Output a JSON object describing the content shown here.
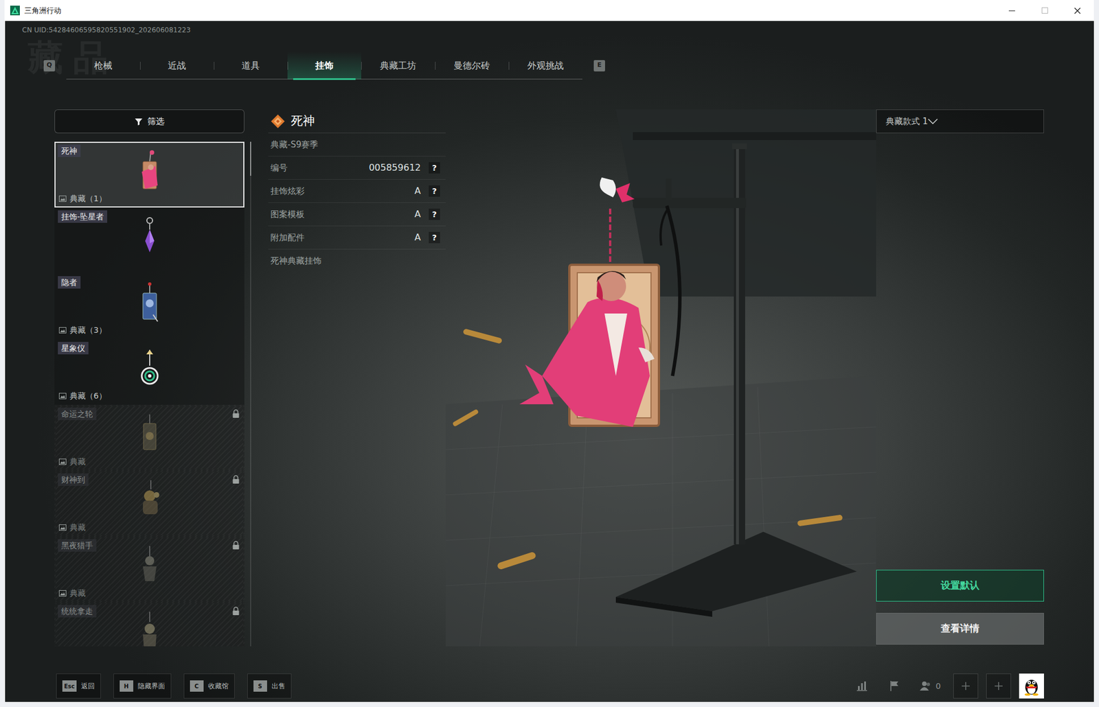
{
  "window": {
    "title": "三角洲行动",
    "maximize_enabled": false
  },
  "uid": "CN UID:54284606595820551902_202606081223",
  "watermark": "藏品",
  "tab_keys": {
    "prev": "Q",
    "next": "E"
  },
  "tabs": [
    {
      "label": "枪械",
      "selected": false
    },
    {
      "label": "近战",
      "selected": false
    },
    {
      "label": "道具",
      "selected": false
    },
    {
      "label": "挂饰",
      "selected": true
    },
    {
      "label": "典藏工坊",
      "selected": false
    },
    {
      "label": "曼德尔砖",
      "selected": false
    },
    {
      "label": "外观挑战",
      "selected": false
    }
  ],
  "filter": {
    "label": "筛选"
  },
  "items": [
    {
      "name": "死神",
      "sub": "典藏（1）",
      "selected": true,
      "locked": false
    },
    {
      "name": "挂饰-坠星者",
      "sub": null,
      "selected": false,
      "locked": false
    },
    {
      "name": "隐者",
      "sub": "典藏（3）",
      "selected": false,
      "locked": false
    },
    {
      "name": "星象仪",
      "sub": "典藏（6）",
      "selected": false,
      "locked": false
    },
    {
      "name": "命运之轮",
      "sub": "典藏",
      "selected": false,
      "locked": true
    },
    {
      "name": "财神到",
      "sub": "典藏",
      "selected": false,
      "locked": true
    },
    {
      "name": "黑夜猎手",
      "sub": "典藏",
      "selected": false,
      "locked": true
    },
    {
      "name": "统统拿走",
      "sub": null,
      "selected": false,
      "locked": true
    }
  ],
  "detail": {
    "title": "死神",
    "season": "典藏-S9赛季",
    "attributes": [
      {
        "label": "编号",
        "value": "005859612",
        "help": "?"
      },
      {
        "label": "挂饰炫彩",
        "value": "A",
        "help": "?"
      },
      {
        "label": "图案模板",
        "value": "A",
        "help": "?"
      },
      {
        "label": "附加配件",
        "value": "A",
        "help": "?"
      }
    ],
    "description": "死神典藏挂饰"
  },
  "style_select": {
    "value": "典藏款式 1"
  },
  "buttons": [
    {
      "label": "设置默认",
      "primary": true
    },
    {
      "label": "查看详情",
      "primary": false
    }
  ],
  "hints": [
    {
      "key": "Esc",
      "label": "返回"
    },
    {
      "key": "H",
      "label": "隐藏界面"
    },
    {
      "key": "C",
      "label": "收藏馆"
    },
    {
      "key": "S",
      "label": "出售"
    }
  ],
  "status": {
    "friends": "0"
  }
}
